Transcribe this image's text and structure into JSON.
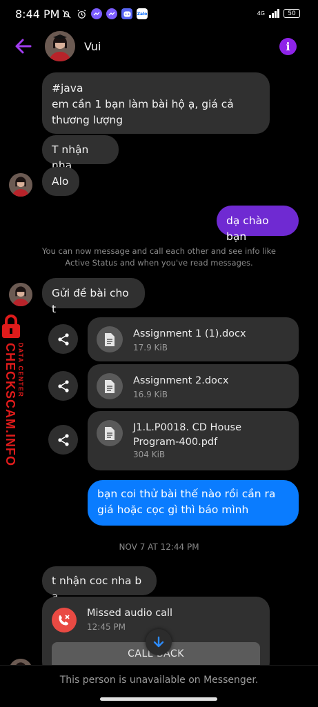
{
  "status_bar": {
    "time": "8:44 PM",
    "network_type": "4G",
    "battery": "50"
  },
  "header": {
    "contact_name": "Vui",
    "info_label": "i"
  },
  "messages": {
    "m1": "#java\nem cần 1 bạn làm bài hộ ạ, giá cả thương lượng",
    "m2": "T nhận nha",
    "m3": "Alo",
    "m4": "dạ chào bạn",
    "notice": "You can now message and call each other and see info like Active Status and when you've read messages.",
    "m5": "Gửi đề bài cho t",
    "m6": "bạn coi thử bài thế nào rồi cần ra giá hoặc cọc gì thì báo mình",
    "date_separator": "NOV 7 AT 12:44 PM",
    "m7": "t nhận coc nha b ạ"
  },
  "attachments": [
    {
      "name": "Assignment 1 (1).docx",
      "size": "17.9 KiB"
    },
    {
      "name": "Assignment 2.docx",
      "size": "16.9 KiB"
    },
    {
      "name": "J1.L.P0018. CD House Program-400.pdf",
      "size": "304 KiB"
    }
  ],
  "call": {
    "title": "Missed audio call",
    "time": "12:45 PM",
    "callback_label": "CALL BACK"
  },
  "footer": {
    "text": "This person is unavailable on Messenger."
  },
  "watermark": {
    "main": "CHECKSCAM.INFO",
    "sub": "DATA CENTER"
  },
  "colors": {
    "accent_purple": "#8e24e8",
    "outgoing_purple": "#6f2ad2",
    "outgoing_blue": "#0a7cff",
    "incoming_bubble": "#303030",
    "missed_call_red": "#e94a43",
    "watermark_red": "#e01b1b"
  }
}
